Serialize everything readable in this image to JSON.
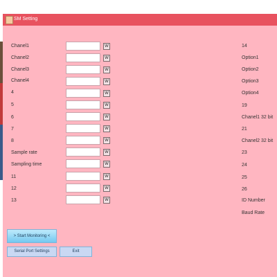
{
  "window": {
    "title": "SM Setting",
    "colors": {
      "background": "#ffb6c1",
      "titlebar": "#e8525f"
    }
  },
  "rows": [
    {
      "label": "Chanel1",
      "input_value": "",
      "write_label": "W"
    },
    {
      "label": "Chanel2",
      "input_value": "",
      "write_label": "W"
    },
    {
      "label": "Chanel3",
      "input_value": "",
      "write_label": "W"
    },
    {
      "label": "Chanel4",
      "input_value": "",
      "write_label": "W"
    },
    {
      "label": "4",
      "input_value": "",
      "write_label": "W"
    },
    {
      "label": "5",
      "input_value": "",
      "write_label": "W"
    },
    {
      "label": "6",
      "input_value": "",
      "write_label": "W"
    },
    {
      "label": "7",
      "input_value": "",
      "write_label": "W"
    },
    {
      "label": "8",
      "input_value": "",
      "write_label": "W"
    },
    {
      "label": "Sample rate",
      "input_value": "",
      "write_label": "W"
    },
    {
      "label": "Sampling time",
      "input_value": "",
      "write_label": "W"
    },
    {
      "label": "11",
      "input_value": "",
      "write_label": "W"
    },
    {
      "label": "12",
      "input_value": "",
      "write_label": "W"
    },
    {
      "label": "13",
      "input_value": "",
      "write_label": "W"
    }
  ],
  "right_labels": [
    "14",
    "Option1",
    "Option2",
    "Option3",
    "Option4",
    "19",
    "Chanel1 32 bit",
    "21",
    "Chanel2 32 bit",
    "23",
    "24",
    "25",
    "26",
    "ID Number",
    "Baud Rate"
  ],
  "buttons": {
    "start": "> Start Monitoring <",
    "serial": "Serial Port Settings",
    "exit": "Exit"
  }
}
